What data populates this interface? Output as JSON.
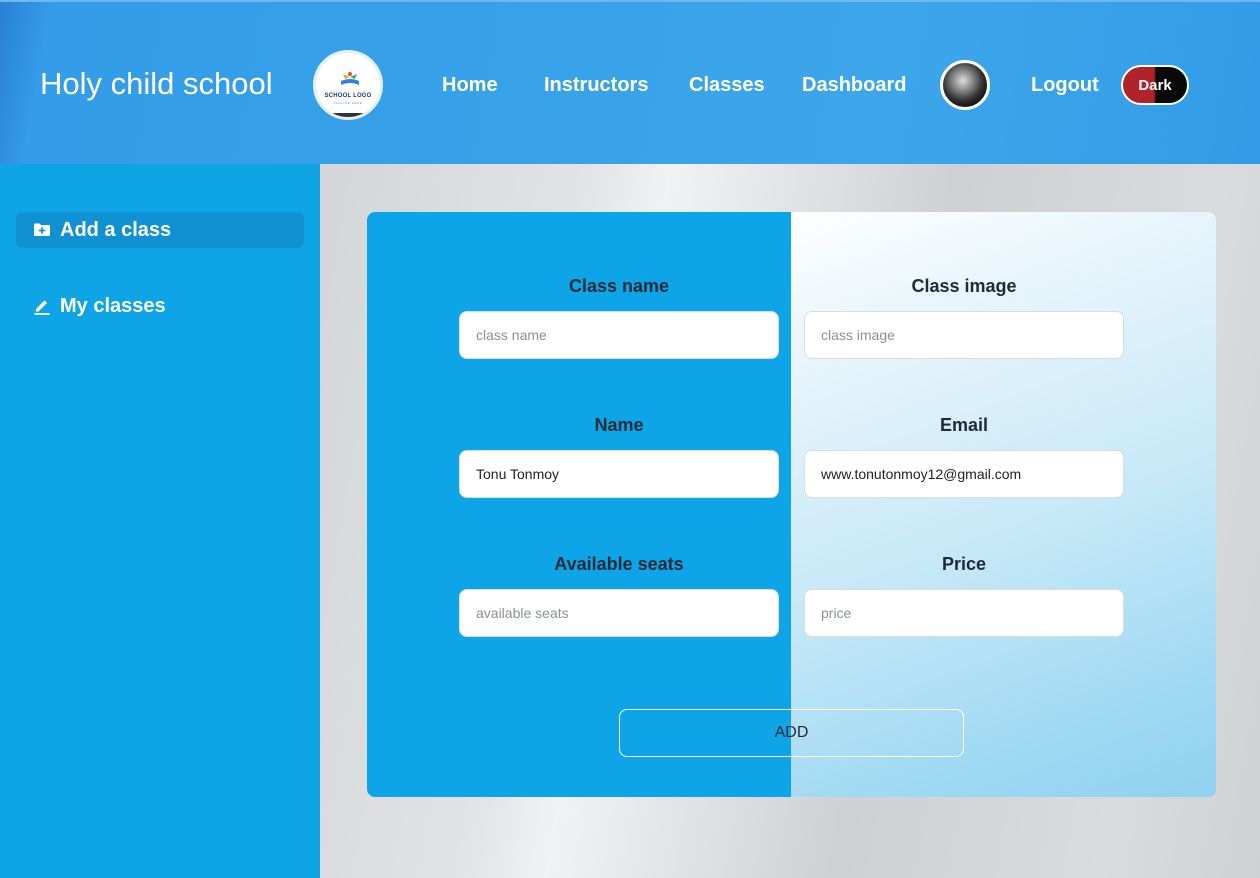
{
  "header": {
    "brand": "Holy child school",
    "logo": {
      "text": "SCHOOL LOGO",
      "subtext": "TAGLINE HERE"
    },
    "nav": [
      "Home",
      "Instructors",
      "Classes",
      "Dashboard"
    ],
    "logout": "Logout",
    "theme_toggle": "Dark"
  },
  "sidebar": {
    "items": [
      {
        "label": "Add a class",
        "icon": "folder-plus-icon",
        "active": true
      },
      {
        "label": "My classes",
        "icon": "pencil-icon",
        "active": false
      }
    ]
  },
  "form": {
    "class_name": {
      "label": "Class name",
      "placeholder": "class name",
      "value": ""
    },
    "class_image": {
      "label": "Class image",
      "placeholder": "class image",
      "value": ""
    },
    "name": {
      "label": "Name",
      "placeholder": "",
      "value": "Tonu Tonmoy"
    },
    "email": {
      "label": "Email",
      "placeholder": "",
      "value": "www.tonutonmoy12@gmail.com"
    },
    "seats": {
      "label": "Available seats",
      "placeholder": "available seats",
      "value": ""
    },
    "price": {
      "label": "Price",
      "placeholder": "price",
      "value": ""
    },
    "submit": "ADD"
  },
  "colors": {
    "header": "#35a0e8",
    "sidebar": "#0fa4e6",
    "toggle_light": "#b0232a",
    "toggle_dark": "#0a0a0a"
  }
}
